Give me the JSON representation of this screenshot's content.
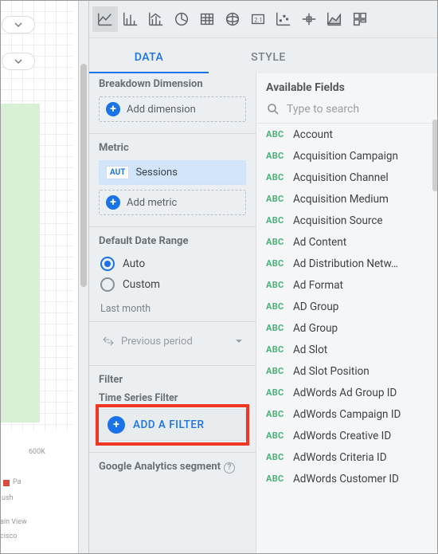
{
  "left_preview": {
    "label_600k": "600K"
  },
  "tabs": {
    "data": "DATA",
    "style": "STYLE"
  },
  "panel": {
    "breakdown": {
      "title": "Breakdown Dimension",
      "add": "Add dimension"
    },
    "metric": {
      "title": "Metric",
      "aut": "AUT",
      "sessions": "Sessions",
      "add": "Add metric"
    },
    "date_range": {
      "title": "Default Date Range",
      "auto": "Auto",
      "custom": "Custom",
      "last_month": "Last month",
      "compare": "Previous period"
    },
    "filter": {
      "title": "Filter",
      "sub": "Time Series Filter",
      "add": "ADD A FILTER"
    },
    "segment": {
      "title": "Google Analytics segment"
    }
  },
  "fields": {
    "header": "Available Fields",
    "search_placeholder": "Type to search",
    "abc": "ABC",
    "items": [
      "Account",
      "Acquisition Campaign",
      "Acquisition Channel",
      "Acquisition Medium",
      "Acquisition Source",
      "Ad Content",
      "Ad Distribution Netw…",
      "Ad Format",
      "AD Group",
      "Ad Group",
      "Ad Slot",
      "Ad Slot Position",
      "AdWords Ad Group ID",
      "AdWords Campaign ID",
      "AdWords Creative ID",
      "AdWords Criteria ID",
      "AdWords Customer ID"
    ]
  }
}
